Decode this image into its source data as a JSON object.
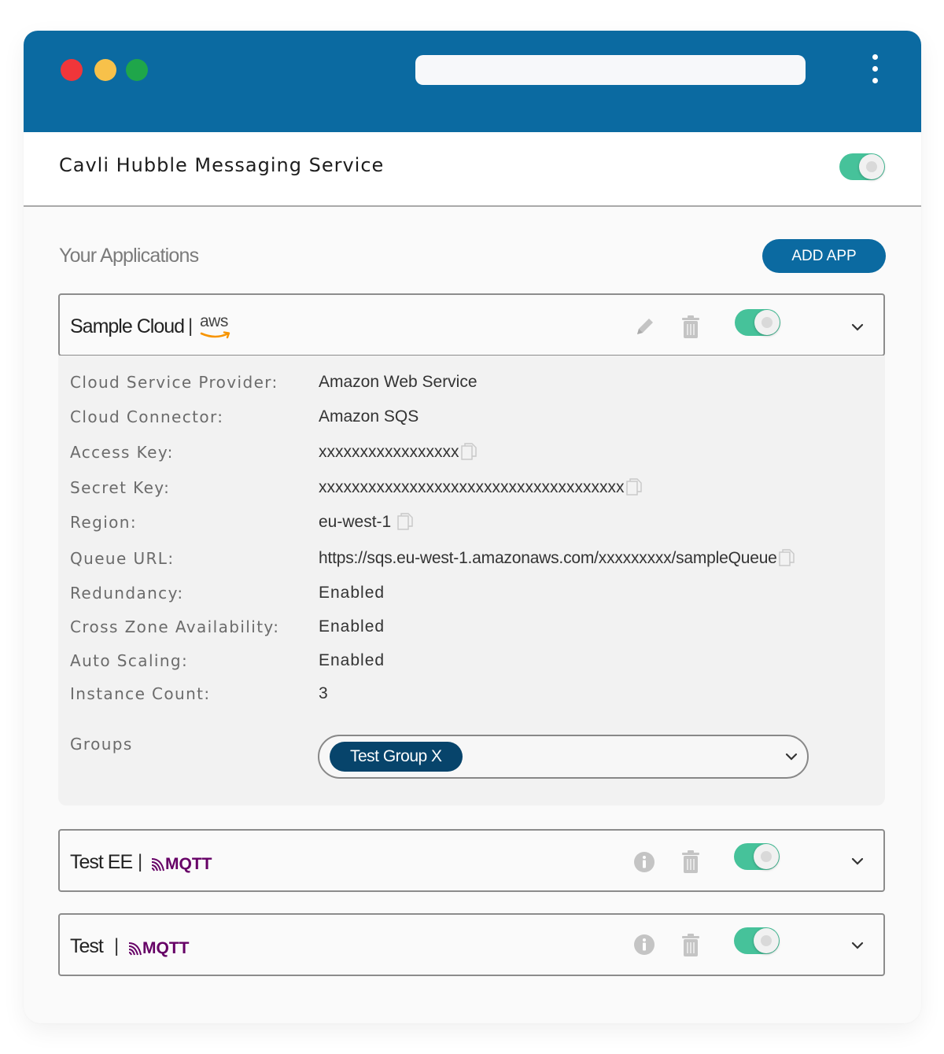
{
  "service": {
    "title": "Cavli Hubble Messaging Service",
    "enabled": true
  },
  "applications": {
    "heading": "Your Applications",
    "add_button_label": "ADD APP",
    "items": [
      {
        "name": "Sample Cloud",
        "separator": "|",
        "provider_logo": "aws",
        "enabled": true,
        "expanded": true,
        "details": [
          {
            "label": "Cloud Service Provider:",
            "value": "Amazon Web Service",
            "copyable": false
          },
          {
            "label": "Cloud Connector:",
            "value": "Amazon SQS",
            "copyable": false
          },
          {
            "label": "Access Key:",
            "value": "xxxxxxxxxxxxxxxxx",
            "copyable": true
          },
          {
            "label": "Secret Key:",
            "value": "xxxxxxxxxxxxxxxxxxxxxxxxxxxxxxxxxxxxx",
            "copyable": true
          },
          {
            "label": "Region:",
            "value": "eu-west-1",
            "copyable": true
          },
          {
            "label": "Queue URL:",
            "value": "https://sqs.eu-west-1.amazonaws.com/xxxxxxxxx/sampleQueue",
            "copyable": true
          },
          {
            "label": "Redundancy:",
            "value": "Enabled",
            "copyable": false
          },
          {
            "label": "Cross Zone Availability:",
            "value": "Enabled",
            "copyable": false
          },
          {
            "label": "Auto Scaling:",
            "value": "Enabled",
            "copyable": false
          },
          {
            "label": "Instance Count:",
            "value": "3",
            "copyable": false
          }
        ],
        "groups_label": "Groups",
        "groups_selected": "Test Group X"
      },
      {
        "name": "Test EE",
        "separator": "|",
        "provider_logo": "MQTT",
        "enabled": true,
        "expanded": false
      },
      {
        "name": "Test",
        "separator": "|",
        "provider_logo": "MQTT",
        "enabled": true,
        "expanded": false
      }
    ]
  },
  "colors": {
    "brand_blue": "#0b6aa1",
    "chip_navy": "#07446b",
    "toggle_on": "#46c29a",
    "mqtt_purple": "#660066",
    "aws_orange": "#f79400"
  },
  "icons": [
    "kebab-menu-icon",
    "pencil-icon",
    "trash-icon",
    "info-icon",
    "chevron-down-icon",
    "copy-icon",
    "mqtt-logo",
    "aws-logo"
  ]
}
